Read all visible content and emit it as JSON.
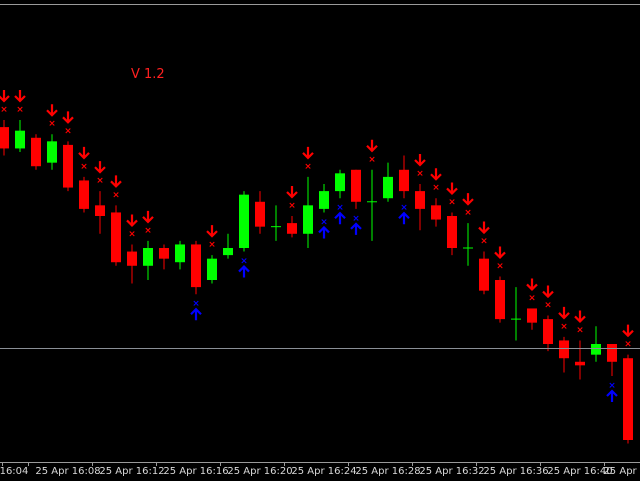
{
  "chart": {
    "version_label": "V 1.2",
    "version_color": "#ff2020",
    "up_color": "#00ff00",
    "down_color": "#ff0000",
    "doji_color": "#00ff00",
    "sell_arrow_color": "#ff0000",
    "buy_arrow_color": "#0000ff",
    "background": "#000000",
    "grid": false
  },
  "time_axis": {
    "labels": [
      "16:04",
      "25 Apr 16:08",
      "25 Apr 16:12",
      "25 Apr 16:16",
      "25 Apr 16:20",
      "25 Apr 16:24",
      "25 Apr 16:28",
      "25 Apr 16:32",
      "25 Apr 16:36",
      "25 Apr 16:40",
      "25 Apr 16"
    ]
  },
  "chart_data": {
    "type": "candlestick",
    "unit_note": "price values in relative units read off the vertical position",
    "y_range": [
      0,
      100
    ],
    "candles": [
      {
        "o": 78,
        "c": 72,
        "h": 80,
        "l": 70,
        "signal": "sell"
      },
      {
        "o": 72,
        "c": 77,
        "h": 80,
        "l": 71,
        "signal": "sell"
      },
      {
        "o": 75,
        "c": 67,
        "h": 76,
        "l": 66,
        "signal": ""
      },
      {
        "o": 68,
        "c": 74,
        "h": 76,
        "l": 66,
        "signal": "sell"
      },
      {
        "o": 73,
        "c": 61,
        "h": 74,
        "l": 60,
        "signal": "sell"
      },
      {
        "o": 63,
        "c": 55,
        "h": 64,
        "l": 54,
        "signal": "sell"
      },
      {
        "o": 56,
        "c": 53,
        "h": 60,
        "l": 48,
        "signal": "sell"
      },
      {
        "o": 54,
        "c": 40,
        "h": 56,
        "l": 39,
        "signal": "sell"
      },
      {
        "o": 43,
        "c": 39,
        "h": 45,
        "l": 34,
        "signal": "sell"
      },
      {
        "o": 39,
        "c": 44,
        "h": 46,
        "l": 35,
        "signal": "sell"
      },
      {
        "o": 44,
        "c": 41,
        "h": 45,
        "l": 38,
        "signal": ""
      },
      {
        "o": 40,
        "c": 45,
        "h": 46,
        "l": 38,
        "signal": ""
      },
      {
        "o": 45,
        "c": 33,
        "h": 46,
        "l": 31,
        "signal": "buy"
      },
      {
        "o": 35,
        "c": 41,
        "h": 42,
        "l": 34,
        "signal": "sell"
      },
      {
        "o": 42,
        "c": 44,
        "h": 48,
        "l": 41,
        "signal": ""
      },
      {
        "o": 44,
        "c": 59,
        "h": 60,
        "l": 43,
        "signal": "buy"
      },
      {
        "o": 57,
        "c": 50,
        "h": 60,
        "l": 48,
        "signal": ""
      },
      {
        "o": 50,
        "c": 50,
        "h": 56,
        "l": 46,
        "signal": ""
      },
      {
        "o": 51,
        "c": 48,
        "h": 53,
        "l": 47,
        "signal": "sell"
      },
      {
        "o": 48,
        "c": 56,
        "h": 64,
        "l": 44,
        "signal": "sell"
      },
      {
        "o": 55,
        "c": 60,
        "h": 62,
        "l": 54,
        "signal": "buy"
      },
      {
        "o": 60,
        "c": 65,
        "h": 66,
        "l": 58,
        "signal": "buy"
      },
      {
        "o": 66,
        "c": 57,
        "h": 66,
        "l": 55,
        "signal": "buy"
      },
      {
        "o": 57,
        "c": 57,
        "h": 66,
        "l": 46,
        "signal": "sell"
      },
      {
        "o": 58,
        "c": 64,
        "h": 68,
        "l": 57,
        "signal": ""
      },
      {
        "o": 66,
        "c": 60,
        "h": 70,
        "l": 58,
        "signal": "buy"
      },
      {
        "o": 60,
        "c": 55,
        "h": 62,
        "l": 49,
        "signal": "sell"
      },
      {
        "o": 56,
        "c": 52,
        "h": 58,
        "l": 50,
        "signal": "sell"
      },
      {
        "o": 53,
        "c": 44,
        "h": 54,
        "l": 42,
        "signal": "sell"
      },
      {
        "o": 44,
        "c": 44,
        "h": 51,
        "l": 39,
        "signal": "sell"
      },
      {
        "o": 41,
        "c": 32,
        "h": 43,
        "l": 31,
        "signal": "sell"
      },
      {
        "o": 35,
        "c": 24,
        "h": 36,
        "l": 23,
        "signal": "sell"
      },
      {
        "o": 24,
        "c": 24,
        "h": 33,
        "l": 18,
        "signal": ""
      },
      {
        "o": 27,
        "c": 23,
        "h": 27,
        "l": 21,
        "signal": "sell"
      },
      {
        "o": 24,
        "c": 17,
        "h": 25,
        "l": 15,
        "signal": "sell"
      },
      {
        "o": 18,
        "c": 13,
        "h": 19,
        "l": 9,
        "signal": "sell"
      },
      {
        "o": 12,
        "c": 11,
        "h": 18,
        "l": 7,
        "signal": "sell"
      },
      {
        "o": 14,
        "c": 17,
        "h": 22,
        "l": 12,
        "signal": ""
      },
      {
        "o": 17,
        "c": 12,
        "h": 17,
        "l": 8,
        "signal": "buy"
      },
      {
        "o": 13,
        "c": -10,
        "h": 14,
        "l": -11,
        "signal": "sell"
      }
    ],
    "current_price": 16
  }
}
